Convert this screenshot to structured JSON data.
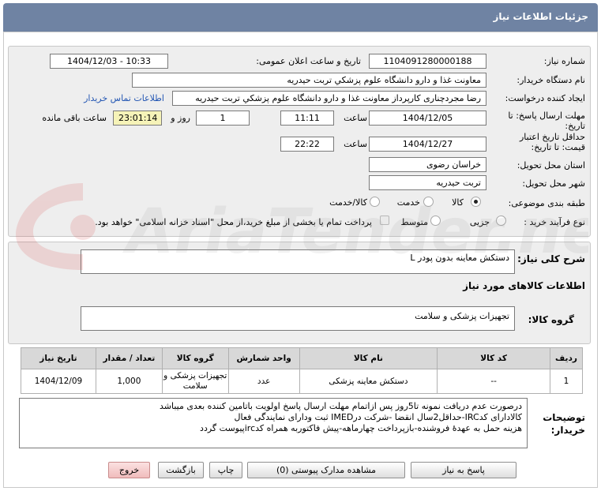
{
  "header": {
    "title": "جزئیات اطلاعات نیاز"
  },
  "fields": {
    "need_number_label": "شماره نیاز:",
    "need_number": "1104091280000188",
    "announce_label": "تاریخ و ساعت اعلان عمومی:",
    "announce_value": "1404/12/03 - 10:33",
    "buyer_org_label": "نام دستگاه خریدار:",
    "buyer_org": "معاونت غذا و دارو   دانشگاه علوم پزشکي تربت حيدريه",
    "creator_label": "ایجاد کننده درخواست:",
    "creator": "رضا مجردچناری کارپرداز معاونت غذا و دارو   دانشگاه علوم پزشکي تربت حيدريه",
    "contact_link": "اطلاعات تماس خریدار",
    "deadline_label": "مهلت ارسال پاسخ: تا تاریخ:",
    "deadline_date": "1404/12/05",
    "time_label": "ساعت",
    "deadline_time": "11:11",
    "days_value": "1",
    "days_label": "روز و",
    "remaining_time": "23:01:14",
    "remaining_label": "ساعت باقی مانده",
    "validity_label": "حداقل تاریخ اعتبار قیمت: تا تاریخ:",
    "validity_date": "1404/12/27",
    "validity_time": "22:22",
    "province_label": "استان محل تحویل:",
    "province": "خراسان رضوی",
    "city_label": "شهر محل تحویل:",
    "city": "تربت حیدریه",
    "category_label": "طبقه بندی موضوعی:",
    "category_options": [
      "کالا",
      "خدمت",
      "کالا/خدمت"
    ],
    "category_selected": "کالا",
    "process_label": "نوع فرآیند خرید :",
    "process_options": [
      "جزیی",
      "متوسط"
    ],
    "payment_note": "پرداخت تمام یا بخشی از مبلغ خرید،از محل \"اسناد خزانه اسلامی\" خواهد بود."
  },
  "summary": {
    "label": "شرح کلی نیاز:",
    "value": "دستکش معاینه بدون پودر L",
    "goods_info_title": "اطلاعات کالاهای مورد نیاز",
    "group_label": "گروه کالا:",
    "group_value": "تجهیزات پزشکی و سلامت"
  },
  "table": {
    "headers": [
      "ردیف",
      "کد کالا",
      "نام کالا",
      "واحد شمارش",
      "گروه کالا",
      "تعداد / مقدار",
      "تاریخ نیاز"
    ],
    "rows": [
      [
        "1",
        "--",
        "دستکش معاینه پزشکی",
        "عدد",
        "تجهیزات پزشکی و سلامت",
        "1,000",
        "1404/12/09"
      ]
    ]
  },
  "notes": {
    "label": "توضیحات خریدار:",
    "lines": [
      "درصورت عدم دریافت نمونه تا5روز پس ازاتمام مهلت ارسال پاسخ اولویت باتامین کننده بعدی میباشد",
      "کالادارای کدIRC-حداقل2سال انقضا -شرکت درIMED ثبت ودارای نمایندگی فعال",
      "هزینه حمل به عهدۀ فروشنده-بازپرداخت چهارماهه-پیش فاکتوربه همراه کدircپیوست گردد"
    ]
  },
  "buttons": {
    "reply": "پاسخ به نیاز",
    "attachments": "مشاهده مدارک پیوستی (0)",
    "print": "چاپ",
    "back": "بازگشت",
    "exit": "خروج"
  },
  "watermark": {
    "text": "AriaTender.neT"
  },
  "colors": {
    "header": "#6f83a3",
    "panel": "#eeeeee",
    "highlight": "#f6f3b8",
    "link": "#2356b3",
    "exit_button": "#f0bcbc"
  }
}
